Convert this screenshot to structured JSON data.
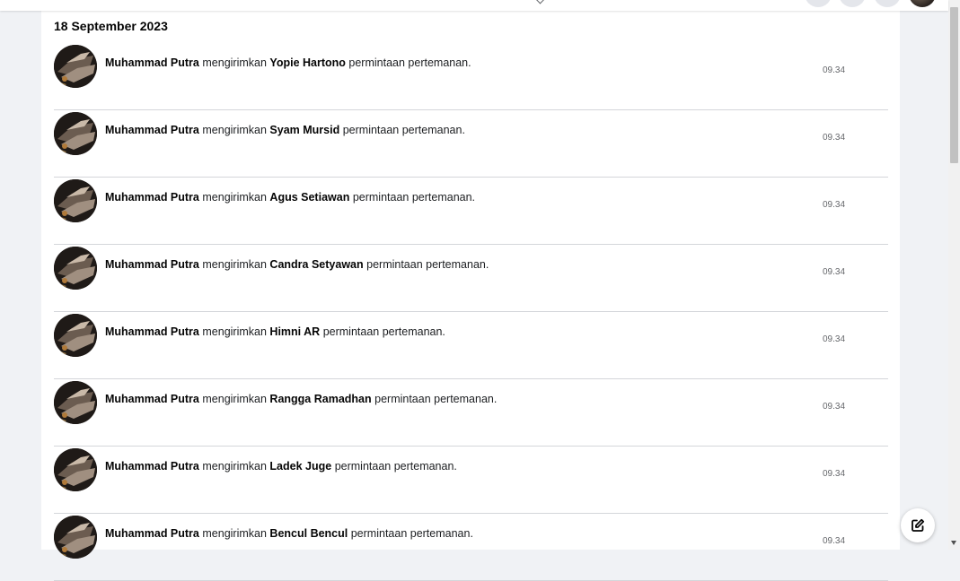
{
  "date_header": "18 September 2023",
  "notifications": [
    {
      "actor": "Muhammad Putra",
      "verb": "mengirimkan",
      "target": "Yopie Hartono",
      "suffix": "permintaan pertemanan.",
      "time": "09.34"
    },
    {
      "actor": "Muhammad Putra",
      "verb": "mengirimkan",
      "target": "Syam Mursid",
      "suffix": "permintaan pertemanan.",
      "time": "09.34"
    },
    {
      "actor": "Muhammad Putra",
      "verb": "mengirimkan",
      "target": "Agus Setiawan",
      "suffix": "permintaan pertemanan.",
      "time": "09.34"
    },
    {
      "actor": "Muhammad Putra",
      "verb": "mengirimkan",
      "target": "Candra Setyawan",
      "suffix": "permintaan pertemanan.",
      "time": "09.34"
    },
    {
      "actor": "Muhammad Putra",
      "verb": "mengirimkan",
      "target": "Himni AR",
      "suffix": "permintaan pertemanan.",
      "time": "09.34"
    },
    {
      "actor": "Muhammad Putra",
      "verb": "mengirimkan",
      "target": "Rangga Ramadhan",
      "suffix": "permintaan pertemanan.",
      "time": "09.34"
    },
    {
      "actor": "Muhammad Putra",
      "verb": "mengirimkan",
      "target": "Ladek Juge",
      "suffix": "permintaan pertemanan.",
      "time": "09.34"
    },
    {
      "actor": "Muhammad Putra",
      "verb": "mengirimkan",
      "target": "Bencul Bencul",
      "suffix": "permintaan pertemanan.",
      "time": "09.34"
    }
  ],
  "icons": {
    "compose": "compose-icon",
    "avatar": "user-avatar"
  },
  "colors": {
    "background": "#f0f2f5",
    "panel": "#ffffff",
    "divider": "#d4d6da",
    "secondary_text": "#65676b"
  }
}
